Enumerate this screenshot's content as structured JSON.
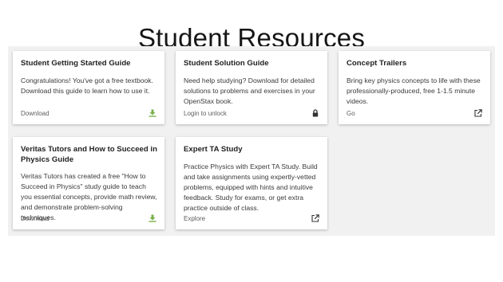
{
  "page": {
    "title": "Student Resources"
  },
  "colors": {
    "download_green": "#78b04a",
    "panel_bg": "#f1f1f1"
  },
  "cards": [
    {
      "title": "Student Getting Started Guide",
      "description": "Congratulations! You've got a free textbook. Download this guide to learn how to use it.",
      "action": "Download",
      "icon": "download-icon"
    },
    {
      "title": "Student Solution Guide",
      "description": "Need help studying? Download for detailed solutions to problems and exercises in your OpenStax book.",
      "action": "Login to unlock",
      "icon": "lock-icon"
    },
    {
      "title": "Concept Trailers",
      "description": "Bring key physics concepts to life with these professionally-produced, free 1-1.5 minute videos.",
      "action": "Go",
      "icon": "external-link-icon"
    },
    {
      "title": "Veritas Tutors and How to Succeed in Physics Guide",
      "description": "Veritas Tutors has created a free \"How to Succeed in Physics\" study guide to teach you essential concepts, provide math review, and demonstrate problem-solving techniques.",
      "action": "Download",
      "icon": "download-icon"
    },
    {
      "title": "Expert TA Study",
      "description": "Practice Physics with Expert TA Study. Build and take assignments using expertly-vetted problems, equipped with hints and intuitive feedback. Study for exams, or get extra practice outside of class.",
      "action": "Explore",
      "icon": "external-link-icon"
    }
  ]
}
